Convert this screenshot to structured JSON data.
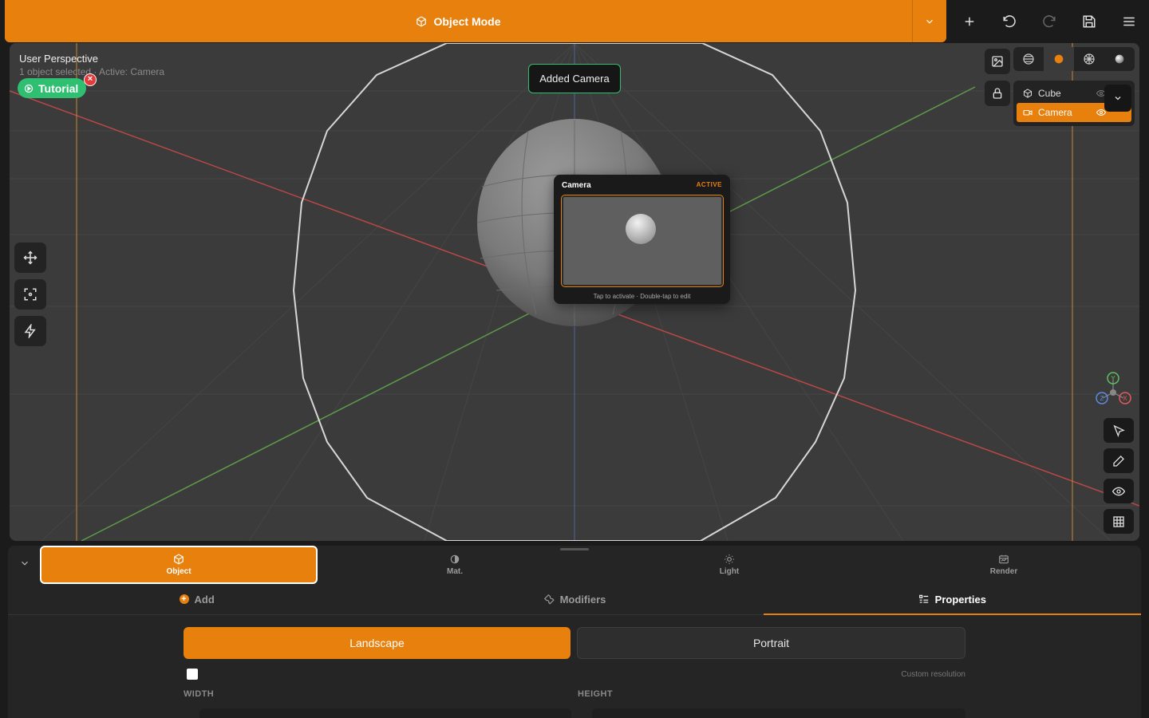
{
  "header": {
    "mode_label": "Object Mode",
    "mode_icon": "cube-icon",
    "tools": [
      "plus-icon",
      "undo-icon",
      "redo-icon",
      "save-icon",
      "menu-icon"
    ]
  },
  "viewport": {
    "title": "User Perspective",
    "subtitle": "1 object selected · Active: Camera",
    "tutorial_label": "Tutorial",
    "toast": "Added Camera",
    "shading_modes": [
      "wireframe-icon",
      "solid-icon",
      "material-icon",
      "rendered-icon"
    ],
    "active_shading": "solid-icon",
    "outliner": [
      {
        "name": "Cube",
        "icon": "cube-icon",
        "selected": false
      },
      {
        "name": "Camera",
        "icon": "camera-icon",
        "selected": true
      }
    ],
    "camera_card": {
      "title": "Camera",
      "badge": "ACTIVE",
      "hint": "Tap to activate · Double-tap to edit"
    },
    "gizmo": {
      "y": "Y",
      "x": "X",
      "z": "Z"
    }
  },
  "panel": {
    "main_tabs": [
      {
        "label": "Object",
        "icon": "cube-icon",
        "active": true
      },
      {
        "label": "Mat.",
        "icon": "material-icon",
        "active": false
      },
      {
        "label": "Light",
        "icon": "sun-icon",
        "active": false
      },
      {
        "label": "Render",
        "icon": "render-icon",
        "active": false
      }
    ],
    "sub_tabs": [
      {
        "label": "Add",
        "active": false
      },
      {
        "label": "Modifiers",
        "active": false
      },
      {
        "label": "Properties",
        "active": true
      }
    ],
    "orientation": {
      "landscape": "Landscape",
      "portrait": "Portrait",
      "selected": "Landscape"
    },
    "custom_resolution_label": "Custom resolution",
    "custom_resolution_checked": false,
    "width_label": "WIDTH",
    "height_label": "HEIGHT"
  },
  "colors": {
    "accent": "#e8800e",
    "success": "#2fbf71",
    "danger": "#e23b3b"
  }
}
